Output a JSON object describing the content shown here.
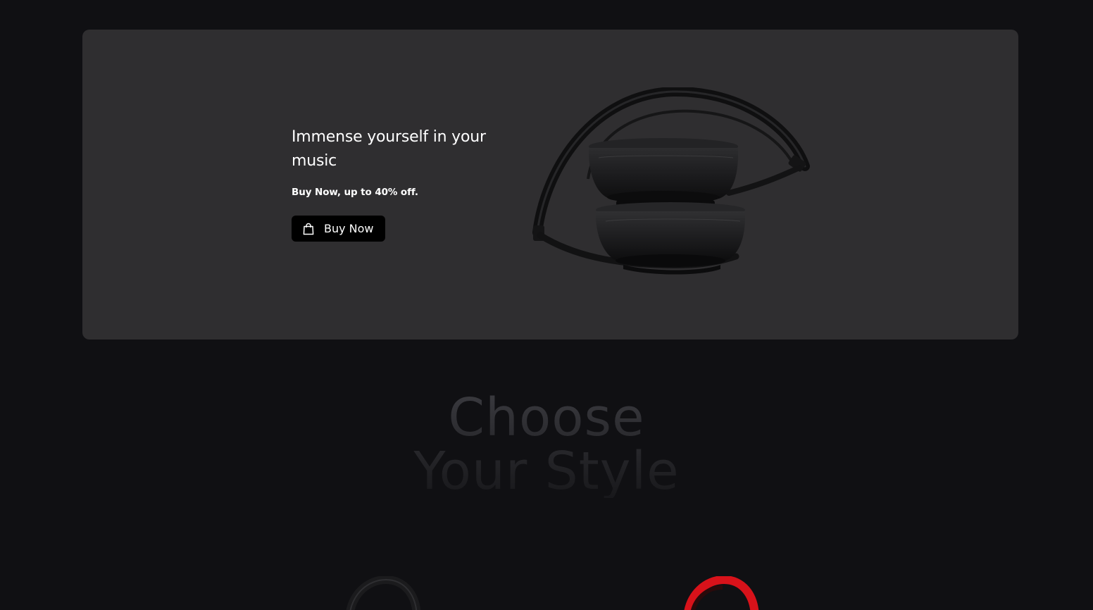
{
  "hero": {
    "title": "Immense yourself in your music",
    "subtitle": "Buy Now, up to 40% off.",
    "button_label": "Buy Now",
    "button_icon": "shopping-bag-icon",
    "image_alt": "headphones-image"
  },
  "section": {
    "title_line1": "Choose",
    "title_line2": "Your Style"
  },
  "products": [
    {
      "name": "",
      "color": "#1a1a1c",
      "icon": "headphones-black"
    },
    {
      "name": "",
      "color": "#e4181e",
      "icon": "headphones-red"
    }
  ],
  "colors": {
    "page_background": "#101013",
    "hero_background": "#2f2e30",
    "button_background": "#000000",
    "text": "#ffffff"
  }
}
